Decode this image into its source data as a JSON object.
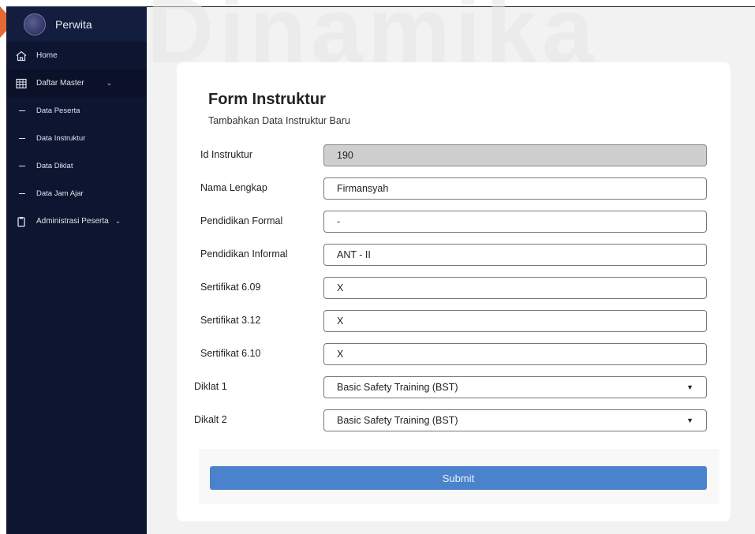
{
  "sidebar": {
    "brand": "Perwita",
    "items": [
      {
        "label": "Home"
      },
      {
        "label": "Daftar Master"
      },
      {
        "label": "Data Peserta"
      },
      {
        "label": "Data Instruktur"
      },
      {
        "label": "Data Diklat"
      },
      {
        "label": "Data Jam Ajar"
      },
      {
        "label": "Administrasi Peserta"
      }
    ]
  },
  "watermark": "Dinamika",
  "form": {
    "title": "Form Instruktur",
    "subtitle": "Tambahkan Data Instruktur Baru",
    "fields": [
      {
        "label": "Id Instruktur",
        "value": "190"
      },
      {
        "label": "Nama Lengkap",
        "value": "Firmansyah"
      },
      {
        "label": "Pendidikan Formal",
        "value": "-"
      },
      {
        "label": "Pendidikan Informal",
        "value": "ANT - II"
      },
      {
        "label": "Sertifikat 6.09",
        "value": "X"
      },
      {
        "label": "Sertifikat 3.12",
        "value": "X"
      },
      {
        "label": "Sertifikat 6.10",
        "value": "X"
      },
      {
        "label": "Diklat 1",
        "value": "Basic Safety Training (BST)"
      },
      {
        "label": "Dikalt 2",
        "value": "Basic Safety Training (BST)"
      }
    ],
    "submit_label": "Submit"
  },
  "colors": {
    "sidebar_bg": "#0d1530",
    "main_bg": "#f2f2f3",
    "submit_bg": "#4a83cc",
    "readonly_bg": "#cfcfcf"
  },
  "icons": {
    "home": "home-icon",
    "master": "grid-icon",
    "admin": "clipboard-icon",
    "dropdown": "triangle-down-icon"
  }
}
